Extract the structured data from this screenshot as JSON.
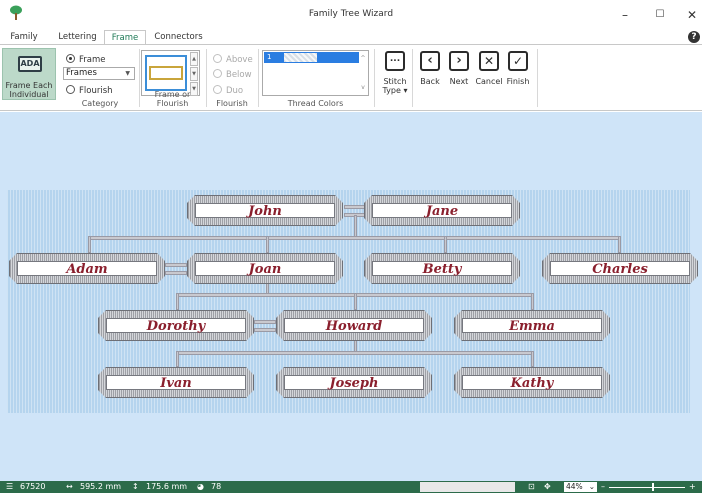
{
  "window": {
    "title": "Family Tree Wizard",
    "minimize": "–",
    "maximize": "☐",
    "close": "✕"
  },
  "tabs": [
    "Family",
    "Lettering",
    "Frame",
    "Connectors"
  ],
  "active_tab": "Frame",
  "help": "?",
  "ribbon": {
    "frame_each": {
      "icon_text": "ADA",
      "label_line1": "Frame Each",
      "label_line2": "Individual"
    },
    "category": {
      "radio_frame": "Frame",
      "radio_flourish": "Flourish",
      "selected": "Frame",
      "dropdown_value": "Frames",
      "group_label": "Category"
    },
    "frame_or_flourish": {
      "group_label": "Frame or Flourish"
    },
    "flourish": {
      "above": "Above",
      "below": "Below",
      "duo": "Duo",
      "group_label": "Flourish"
    },
    "thread_colors": {
      "row1_num": "1",
      "group_label": "Thread Colors"
    },
    "stitch_type": {
      "icon_text": "...",
      "label_line1": "Stitch",
      "label_line2": "Type ▾"
    },
    "nav": {
      "back": "Back",
      "next": "Next",
      "cancel": "Cancel",
      "finish": "Finish"
    }
  },
  "tree": {
    "names": [
      "John",
      "Jane",
      "Adam",
      "Joan",
      "Betty",
      "Charles",
      "Dorothy",
      "Howard",
      "Emma",
      "Ivan",
      "Joseph",
      "Kathy"
    ]
  },
  "status": {
    "stitches": "67520",
    "width": "595.2 mm",
    "height": "175.6 mm",
    "colors": "78",
    "zoom": "44%"
  },
  "colors": {
    "accent": "#2c6b4a",
    "canvas_bg": "#cfe4f8",
    "name_text": "#8a1f2d"
  }
}
